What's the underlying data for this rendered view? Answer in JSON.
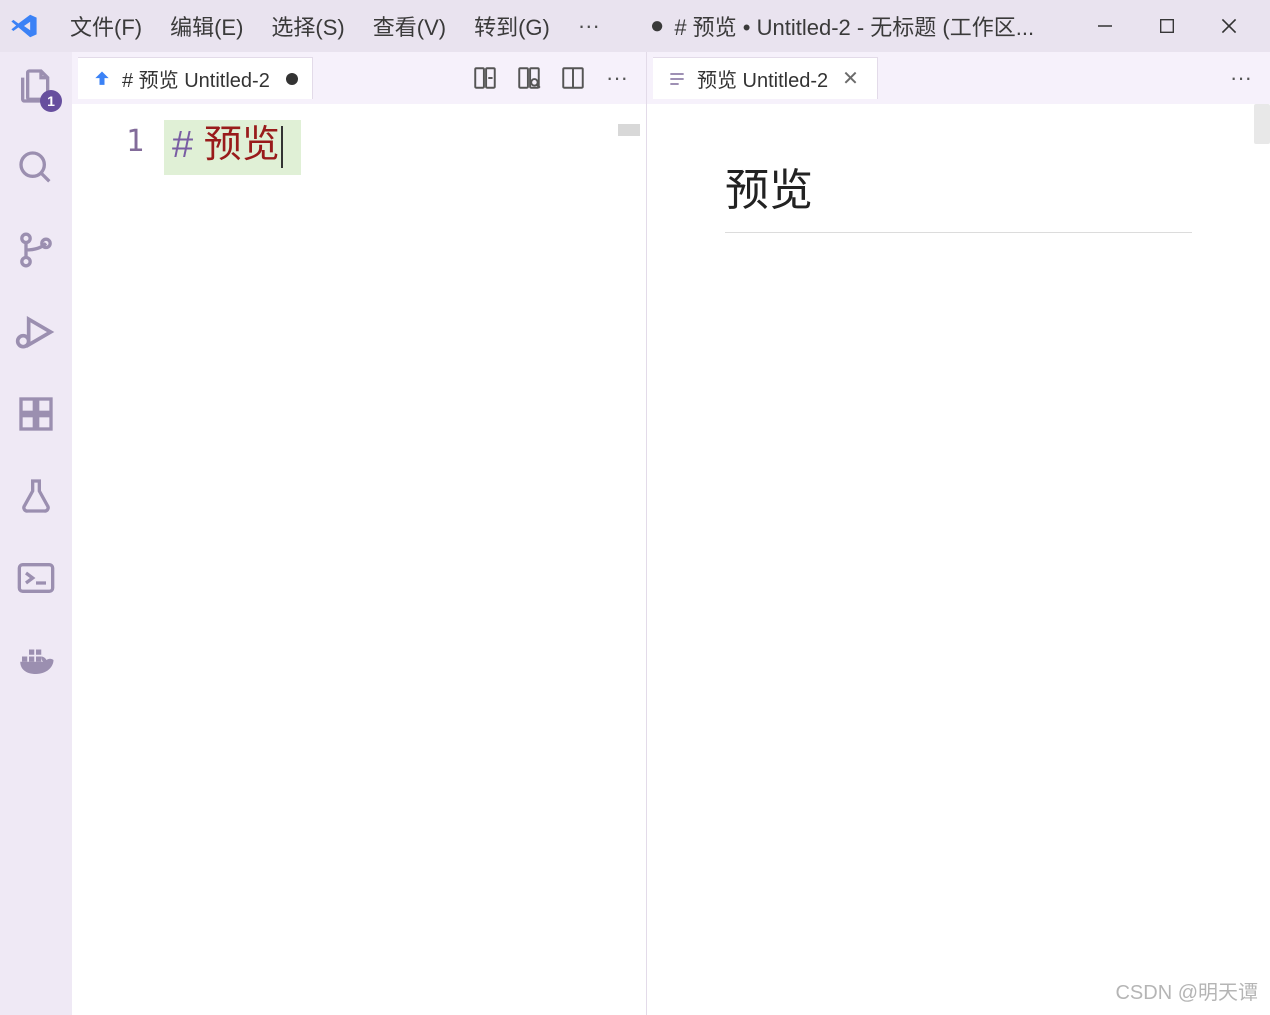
{
  "titlebar": {
    "menu": {
      "file": "文件(F)",
      "edit": "编辑(E)",
      "select": "选择(S)",
      "view": "查看(V)",
      "go": "转到(G)"
    },
    "title": "# 预览 • Untitled-2 - 无标题 (工作区...",
    "title_modified_indicator": "●"
  },
  "activitybar": {
    "explorer_badge": "1"
  },
  "editor_left": {
    "tab_label": "# 预览  Untitled-2",
    "line_number": "1",
    "code_hash": "# ",
    "code_text": "预览"
  },
  "editor_right": {
    "tab_label": "预览 Untitled-2",
    "preview_heading": "预览"
  },
  "watermark": "CSDN @明天谭"
}
